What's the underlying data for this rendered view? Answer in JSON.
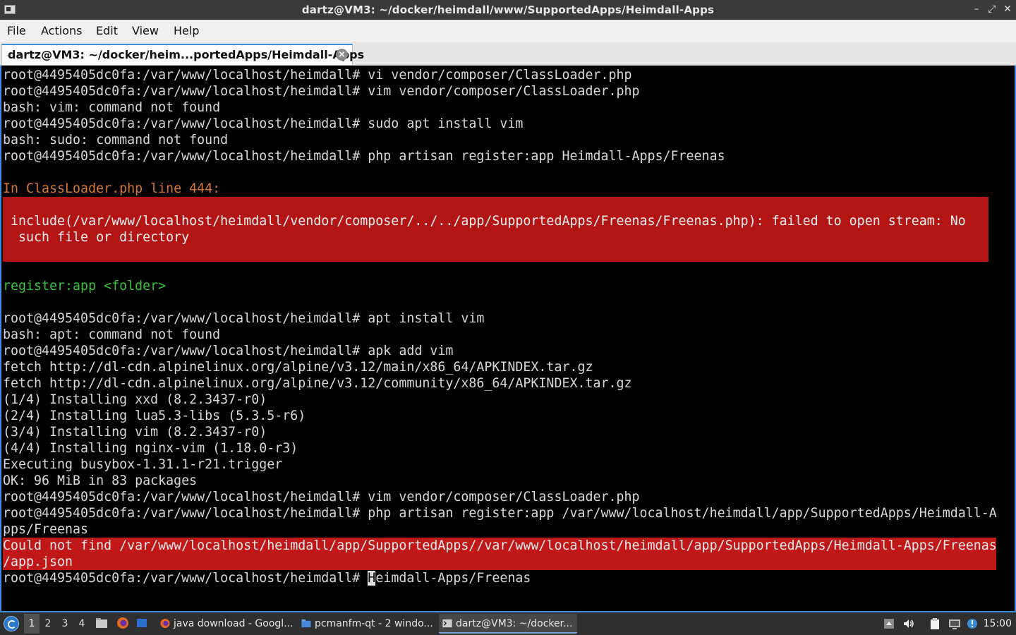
{
  "window": {
    "title": "dartz@VM3: ~/docker/heimdall/www/SupportedApps/Heimdall-Apps",
    "minimize_glyph": "–",
    "maximize_glyph": "⤢",
    "close_glyph": "✕"
  },
  "menubar": {
    "items": [
      "File",
      "Actions",
      "Edit",
      "View",
      "Help"
    ]
  },
  "tabs": [
    {
      "label": "dartz@VM3: ~/docker/heim...portedApps/Heimdall-Apps",
      "close_glyph": "×"
    }
  ],
  "terminal": {
    "lines": [
      "root@4495405dc0fa:/var/www/localhost/heimdall# vi vendor/composer/ClassLoader.php",
      "root@4495405dc0fa:/var/www/localhost/heimdall# vim vendor/composer/ClassLoader.php",
      "bash: vim: command not found",
      "root@4495405dc0fa:/var/www/localhost/heimdall# sudo apt install vim",
      "bash: sudo: command not found",
      "root@4495405dc0fa:/var/www/localhost/heimdall# php artisan register:app Heimdall-Apps/Freenas"
    ],
    "exception_header": "In ClassLoader.php line 444:",
    "exception_lines": [
      " include(/var/www/localhost/heimdall/vendor/composer/../../app/SupportedApps/Freenas/Freenas.php): failed to open stream: No",
      "  such file or directory"
    ],
    "usage_line": "register:app <folder>",
    "lines2": [
      "root@4495405dc0fa:/var/www/localhost/heimdall# apt install vim",
      "bash: apt: command not found",
      "root@4495405dc0fa:/var/www/localhost/heimdall# apk add vim",
      "fetch http://dl-cdn.alpinelinux.org/alpine/v3.12/main/x86_64/APKINDEX.tar.gz",
      "fetch http://dl-cdn.alpinelinux.org/alpine/v3.12/community/x86_64/APKINDEX.tar.gz",
      "(1/4) Installing xxd (8.2.3437-r0)",
      "(2/4) Installing lua5.3-libs (5.3.5-r6)",
      "(3/4) Installing vim (8.2.3437-r0)",
      "(4/4) Installing nginx-vim (1.18.0-r3)",
      "Executing busybox-1.31.1-r21.trigger",
      "OK: 96 MiB in 83 packages",
      "root@4495405dc0fa:/var/www/localhost/heimdall# vim vendor/composer/ClassLoader.php",
      "root@4495405dc0fa:/var/www/localhost/heimdall# php artisan register:app /var/www/localhost/heimdall/app/SupportedApps/Heimdall-A",
      "pps/Freenas"
    ],
    "error_lines": [
      "Could not find /var/www/localhost/heimdall/app/SupportedApps//var/www/localhost/heimdall/app/SupportedApps/Heimdall-Apps/Freenas",
      "/app.json"
    ],
    "prompt": "root@4495405dc0fa:/var/www/localhost/heimdall# ",
    "cursor_char": "H",
    "current_input_rest": "eimdall-Apps/Freenas"
  },
  "taskbar": {
    "desktops": [
      "1",
      "2",
      "3",
      "4"
    ],
    "tasks": [
      {
        "label": "java download - Googl...",
        "icon": "firefox-icon"
      },
      {
        "label": "pcmanfm-qt - 2 windo...",
        "icon": "folder-icon"
      },
      {
        "label": "dartz@VM3: ~/docker...",
        "icon": "terminal-icon"
      }
    ],
    "clock": "15:00"
  },
  "colors": {
    "titlebar_bg": "#3a3a3a",
    "error_bg": "#b31515",
    "orange_text": "#d9773a",
    "green_text": "#35c33a",
    "accent": "#3b8de0"
  }
}
